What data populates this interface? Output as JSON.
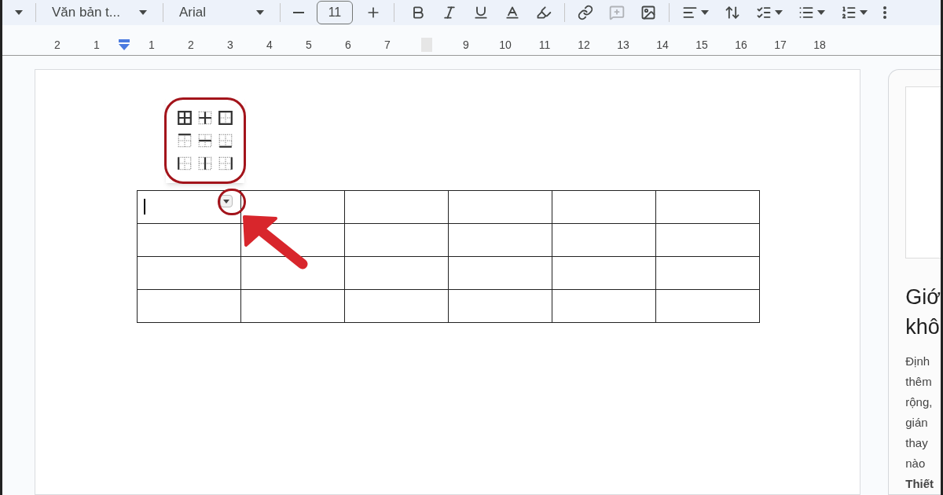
{
  "toolbar": {
    "style_dropdown": "Văn bản t...",
    "font_dropdown": "Arial",
    "font_size": "11",
    "tools": [
      {
        "kind": "bold",
        "disabled": false,
        "dropdown": false
      },
      {
        "kind": "italic",
        "disabled": false,
        "dropdown": false
      },
      {
        "kind": "underline",
        "disabled": false,
        "dropdown": false
      },
      {
        "kind": "text_color",
        "disabled": false,
        "dropdown": false
      },
      {
        "kind": "highlight",
        "disabled": false,
        "dropdown": false
      },
      {
        "kind": "link",
        "disabled": false,
        "dropdown": false
      },
      {
        "kind": "comment",
        "disabled": true,
        "dropdown": false
      },
      {
        "kind": "image",
        "disabled": false,
        "dropdown": false
      },
      {
        "kind": "align",
        "disabled": false,
        "dropdown": true
      },
      {
        "kind": "line_spacing",
        "disabled": false,
        "dropdown": false
      },
      {
        "kind": "checklist",
        "disabled": false,
        "dropdown": true
      },
      {
        "kind": "bullets",
        "disabled": false,
        "dropdown": true
      },
      {
        "kind": "numbering",
        "disabled": false,
        "dropdown": true
      },
      {
        "kind": "more",
        "disabled": false,
        "dropdown": false
      }
    ]
  },
  "ruler": {
    "left_numbers": [
      "2",
      "1"
    ],
    "numbers": [
      "1",
      "2",
      "3",
      "4",
      "5",
      "6",
      "7"
    ],
    "numbers_after_gap": [
      "9",
      "10",
      "11",
      "12",
      "13",
      "14",
      "15",
      "16",
      "17",
      "18"
    ]
  },
  "border_menu": [
    {
      "kind": "all"
    },
    {
      "kind": "inner"
    },
    {
      "kind": "outer"
    },
    {
      "kind": "top"
    },
    {
      "kind": "horizontal"
    },
    {
      "kind": "bottom"
    },
    {
      "kind": "left"
    },
    {
      "kind": "vertical"
    },
    {
      "kind": "right"
    }
  ],
  "table": {
    "rows": [
      {
        "cells": [
          {
            "cursor": true,
            "menu": true
          },
          {
            "cursor": false,
            "menu": false
          },
          {
            "cursor": false,
            "menu": false
          },
          {
            "cursor": false,
            "menu": false
          },
          {
            "cursor": false,
            "menu": false
          },
          {
            "cursor": false,
            "menu": false
          }
        ]
      },
      {
        "cells": [
          {
            "cursor": false,
            "menu": false
          },
          {
            "cursor": false,
            "menu": false
          },
          {
            "cursor": false,
            "menu": false
          },
          {
            "cursor": false,
            "menu": false
          },
          {
            "cursor": false,
            "menu": false
          },
          {
            "cursor": false,
            "menu": false
          }
        ]
      },
      {
        "cells": [
          {
            "cursor": false,
            "menu": false
          },
          {
            "cursor": false,
            "menu": false
          },
          {
            "cursor": false,
            "menu": false
          },
          {
            "cursor": false,
            "menu": false
          },
          {
            "cursor": false,
            "menu": false
          },
          {
            "cursor": false,
            "menu": false
          }
        ]
      },
      {
        "cells": [
          {
            "cursor": false,
            "menu": false
          },
          {
            "cursor": false,
            "menu": false
          },
          {
            "cursor": false,
            "menu": false
          },
          {
            "cursor": false,
            "menu": false
          },
          {
            "cursor": false,
            "menu": false
          },
          {
            "cursor": false,
            "menu": false
          }
        ]
      }
    ]
  },
  "side_card": {
    "heading_lines": [
      "Giớ",
      "khô"
    ],
    "body_lines": [
      {
        "text": "Định",
        "bold": false
      },
      {
        "text": "thêm",
        "bold": false
      },
      {
        "text": "rộng,",
        "bold": false
      },
      {
        "text": "gián",
        "bold": false
      },
      {
        "text": "thay",
        "bold": false
      },
      {
        "text": "nào",
        "bold": false
      },
      {
        "text": "Thiết",
        "bold": true
      }
    ]
  }
}
